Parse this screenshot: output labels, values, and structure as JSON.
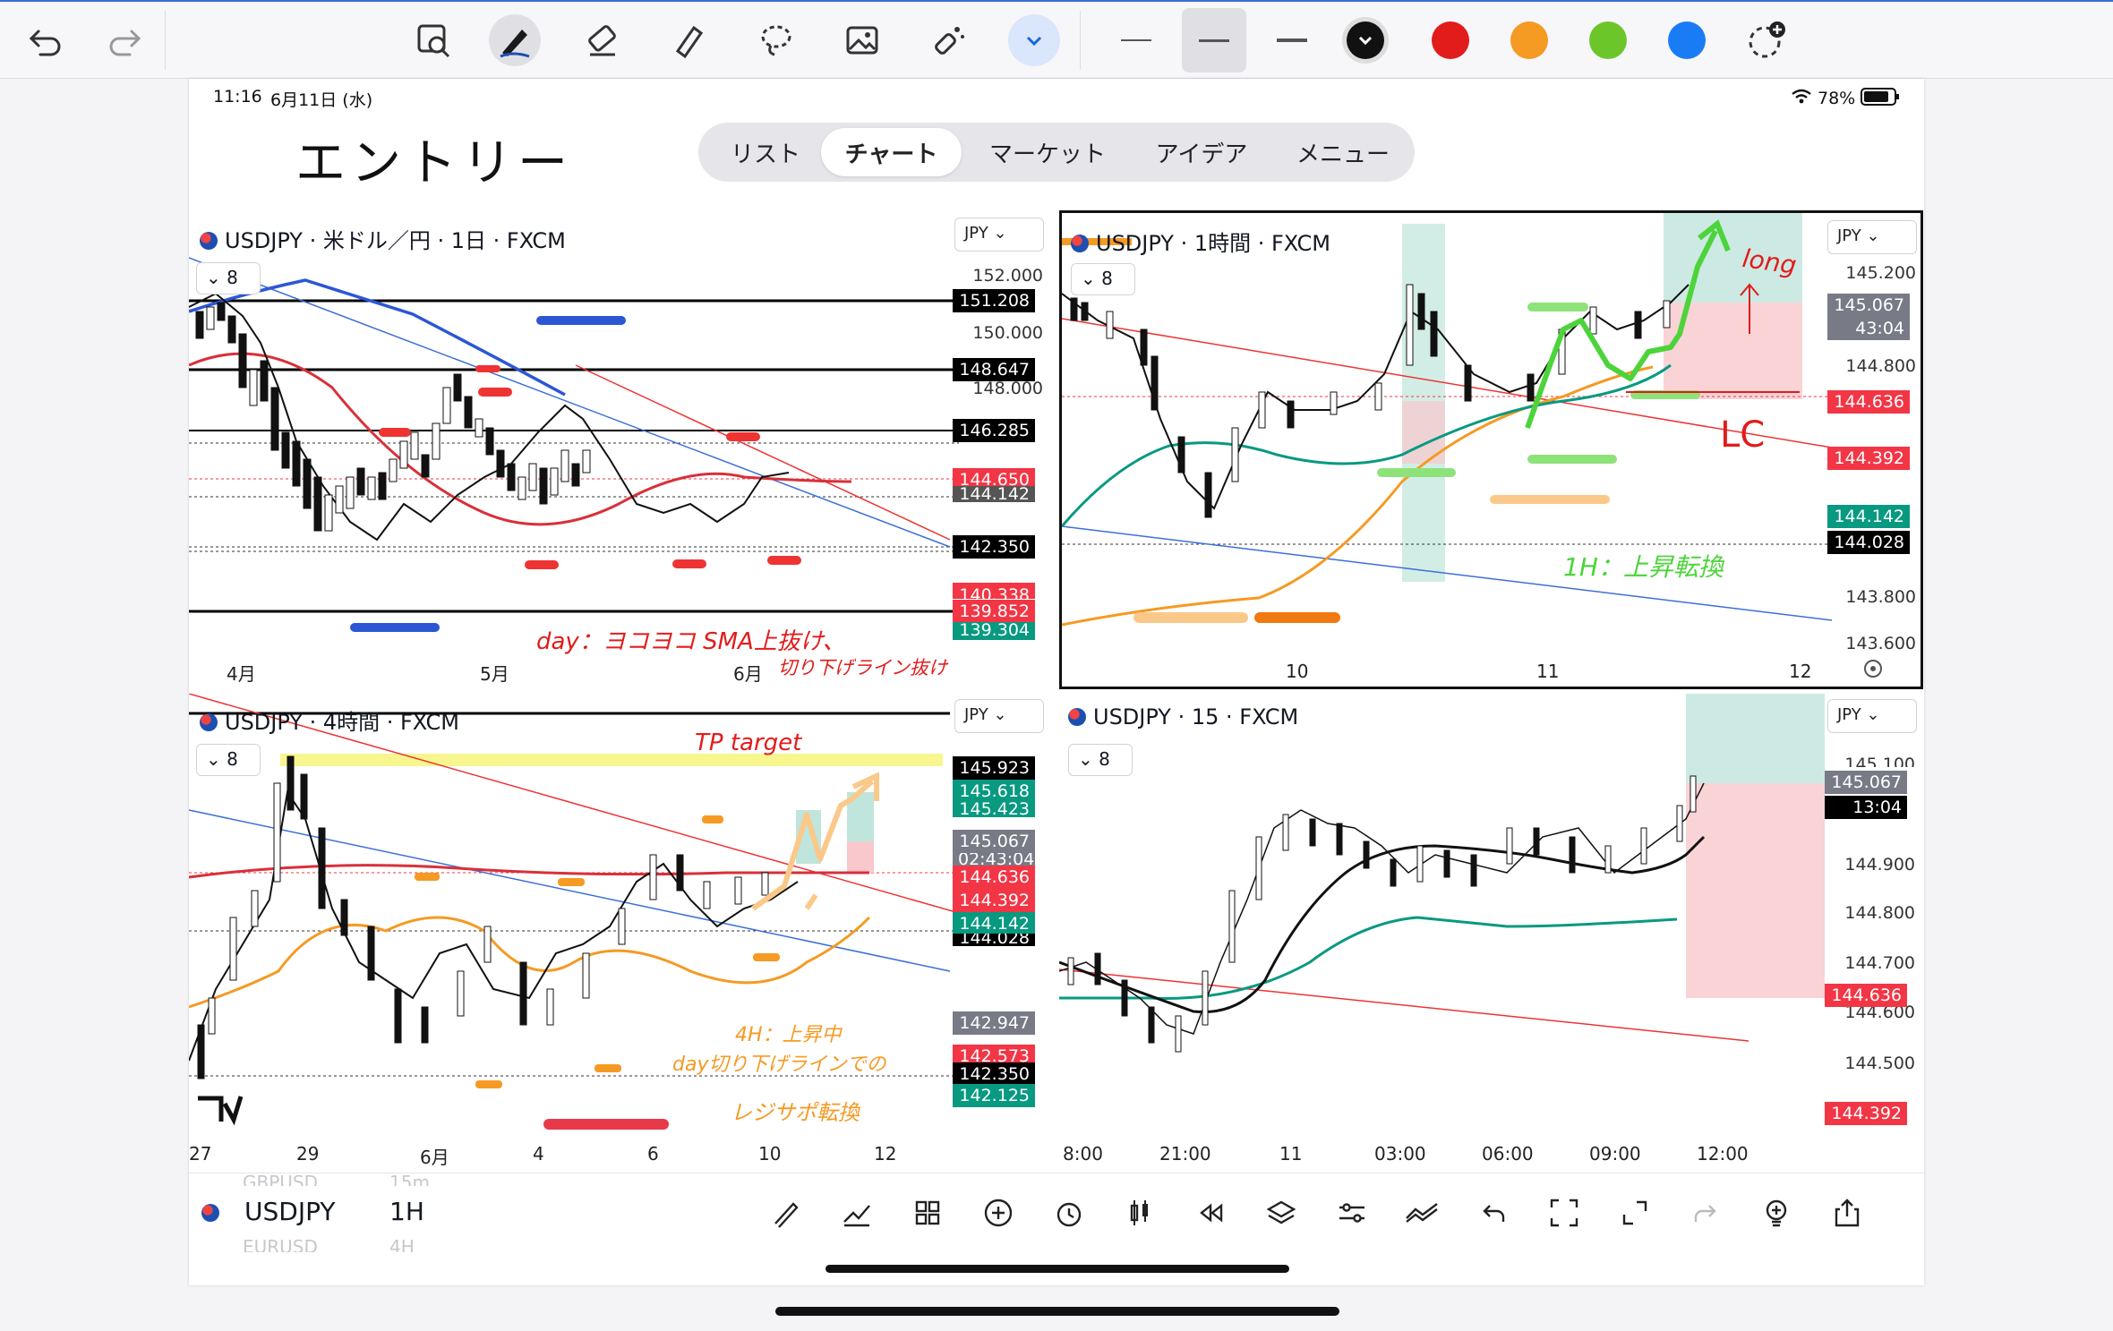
{
  "toolbar": {
    "undo": "undo-icon",
    "redo": "redo-icon",
    "tools": [
      "image-zoom-icon",
      "pen-icon",
      "eraser-icon",
      "highlighter-icon",
      "lasso-icon",
      "image-icon",
      "magic-tool-icon"
    ],
    "line_weights": [
      "thin",
      "medium",
      "thick"
    ],
    "colors": [
      "#111111",
      "#e21b1b",
      "#f59a23",
      "#6cc62a",
      "#1a7cf5"
    ]
  },
  "status": {
    "time": "11:16",
    "date": "6月11日 (水)",
    "battery": "78%"
  },
  "handwritten_title": "エントリー",
  "tabs": [
    "リスト",
    "チャート",
    "マーケット",
    "アイデア",
    "メニュー"
  ],
  "active_tab": "チャート",
  "panels": {
    "daily": {
      "title": "USDJPY · 米ドル／円 · 1日 · FXCM",
      "currency": "JPY",
      "count": "8",
      "price_labels": [
        "152.000",
        "150.000",
        "148.000"
      ],
      "tags": [
        {
          "text": "151.208",
          "color": "#000000"
        },
        {
          "text": "148.647",
          "color": "#000000"
        },
        {
          "text": "146.285",
          "color": "#000000"
        },
        {
          "text": "144.650",
          "color": "#f23645"
        },
        {
          "text": "144.142",
          "color": "#555555"
        },
        {
          "text": "142.350",
          "color": "#000000"
        },
        {
          "text": "140.338",
          "color": "#555555"
        },
        {
          "text": "139.852",
          "color": "#f23645"
        },
        {
          "text": "139.304",
          "color": "#089981"
        }
      ],
      "x_labels": [
        "4月",
        "5月",
        "6月"
      ],
      "annotation_1": "day：ヨコヨコ SMA上抜け、",
      "annotation_2": "切り下げライン抜け"
    },
    "h1": {
      "title": "USDJPY · 1時間 · FXCM",
      "currency": "JPY",
      "count": "8",
      "price_labels": [
        "145.200",
        "144.800",
        "143.800",
        "143.600"
      ],
      "tags": [
        {
          "text": "145.067",
          "color": "#787b86"
        },
        {
          "text": "43:04",
          "color": "#787b86"
        },
        {
          "text": "144.636",
          "color": "#f23645"
        },
        {
          "text": "144.392",
          "color": "#f23645"
        },
        {
          "text": "144.142",
          "color": "#089981"
        },
        {
          "text": "144.028",
          "color": "#000000"
        }
      ],
      "x_labels": [
        "10",
        "11",
        "12"
      ],
      "annotation_long": "long",
      "annotation_lc": "LC",
      "annotation_trend": "1H：上昇転換"
    },
    "h4": {
      "title": "USDJPY · 4時間 · FXCM",
      "currency": "JPY",
      "count": "8",
      "tags": [
        {
          "text": "145.923",
          "color": "#000000"
        },
        {
          "text": "145.618",
          "color": "#089981"
        },
        {
          "text": "145.423",
          "color": "#089981"
        },
        {
          "text": "145.067",
          "color": "#787b86"
        },
        {
          "text": "02:43:04",
          "color": "#787b86"
        },
        {
          "text": "144.636",
          "color": "#f23645"
        },
        {
          "text": "144.392",
          "color": "#f23645"
        },
        {
          "text": "144.142",
          "color": "#089981"
        },
        {
          "text": "144.028",
          "color": "#000000"
        },
        {
          "text": "142.947",
          "color": "#787b86"
        },
        {
          "text": "142.573",
          "color": "#f23645"
        },
        {
          "text": "142.350",
          "color": "#000000"
        },
        {
          "text": "142.125",
          "color": "#089981"
        }
      ],
      "x_labels": [
        "27",
        "29",
        "6月",
        "4",
        "6",
        "10",
        "12"
      ],
      "annotation_tp": "TP target",
      "annotation_1": "4H：上昇中",
      "annotation_2": "day切り下げラインでの",
      "annotation_3": "レジサポ転換"
    },
    "m15": {
      "title": "USDJPY · 15 · FXCM",
      "currency": "JPY",
      "count": "8",
      "price_labels": [
        "145.100",
        "144.900",
        "144.800",
        "144.700",
        "144.600",
        "144.500"
      ],
      "tags": [
        {
          "text": "145.067",
          "color": "#787b86"
        },
        {
          "text": "13:04",
          "color": "#000000"
        },
        {
          "text": "144.636",
          "color": "#f23645"
        },
        {
          "text": "144.392",
          "color": "#f23645"
        }
      ],
      "x_labels": [
        "8:00",
        "21:00",
        "11",
        "03:00",
        "06:00",
        "09:00",
        "12:00"
      ]
    }
  },
  "bottom": {
    "symbol": "USDJPY",
    "interval": "1H",
    "faded_above": "GBPUSD",
    "faded_above_tf": "15m",
    "faded_below": "EURUSD",
    "faded_below_tf": "4H",
    "tools": [
      "draw-icon",
      "indicators-icon",
      "layout-icon",
      "add-icon",
      "alarm-icon",
      "candle-icon",
      "replay-icon",
      "layers-icon",
      "settings-icon",
      "compare-icon",
      "undo-icon",
      "fullscreen-icon",
      "expand-icon",
      "redo-icon",
      "idea-icon",
      "share-icon"
    ]
  }
}
